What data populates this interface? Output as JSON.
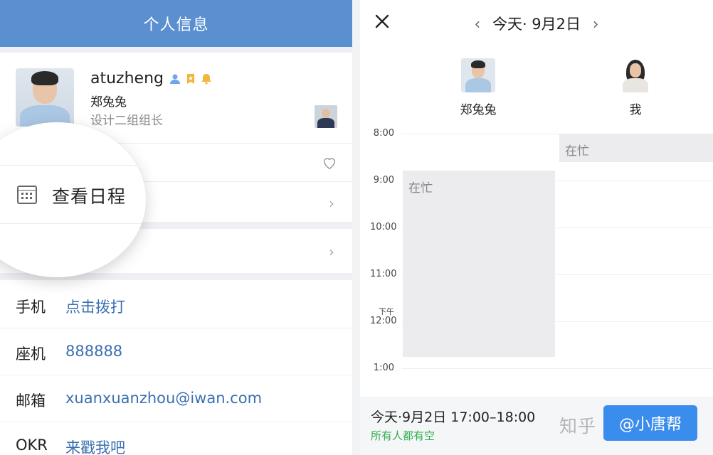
{
  "profile_panel": {
    "header_title": "个人信息",
    "user": {
      "account": "atuzheng",
      "nickname": "郑兔兔",
      "position": "设计二组组长",
      "badge_icons": [
        "person-icon",
        "bookmark-star-icon",
        "bell-icon"
      ]
    },
    "schedule_label": "查看日程",
    "contact_rows": [
      {
        "label": "手机",
        "value": "点击拨打"
      },
      {
        "label": "座机",
        "value": "888888"
      },
      {
        "label": "邮箱",
        "value": "xuanxuanzhou@iwan.com"
      },
      {
        "label": "OKR",
        "value": "来戳我吧"
      }
    ],
    "colors": {
      "header_bg": "#5a8fd0",
      "link": "#3a6fb0"
    }
  },
  "calendar_panel": {
    "date_title": "今天· 9月2日",
    "participants": [
      {
        "name": "郑兔兔"
      },
      {
        "name": "我"
      }
    ],
    "time_labels": {
      "t1": "8:00",
      "t2": "9:00",
      "t3": "10:00",
      "t4": "11:00",
      "t5_prefix": "下午",
      "t5": "12:00",
      "t6": "1:00"
    },
    "busy_label": "在忙",
    "footer": {
      "slot": "今天·9月2日 17:00–18:00",
      "status": "所有人都有空",
      "button_label": "@小唐帮"
    },
    "watermark": "知乎",
    "colors": {
      "button_bg": "#3b8ded",
      "status_green": "#2fae4f",
      "busy_bg": "#ececee"
    }
  }
}
